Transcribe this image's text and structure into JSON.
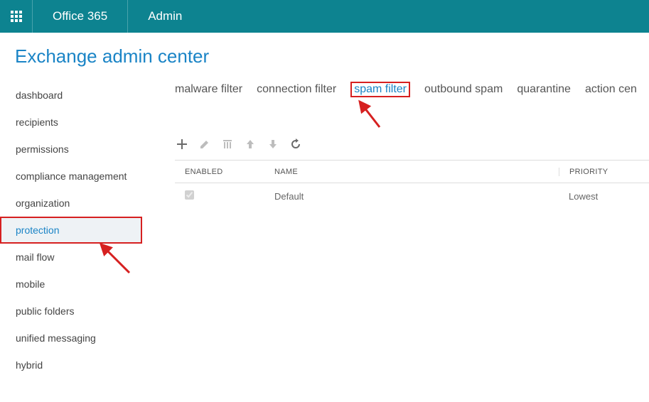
{
  "topbar": {
    "brand": "Office 365",
    "admin": "Admin"
  },
  "pageTitle": "Exchange admin center",
  "sidebar": {
    "items": [
      {
        "label": "dashboard"
      },
      {
        "label": "recipients"
      },
      {
        "label": "permissions"
      },
      {
        "label": "compliance management"
      },
      {
        "label": "organization"
      },
      {
        "label": "protection"
      },
      {
        "label": "mail flow"
      },
      {
        "label": "mobile"
      },
      {
        "label": "public folders"
      },
      {
        "label": "unified messaging"
      },
      {
        "label": "hybrid"
      }
    ]
  },
  "tabs": [
    {
      "label": "malware filter"
    },
    {
      "label": "connection filter"
    },
    {
      "label": "spam filter"
    },
    {
      "label": "outbound spam"
    },
    {
      "label": "quarantine"
    },
    {
      "label": "action cen"
    }
  ],
  "table": {
    "headers": {
      "enabled": "ENABLED",
      "name": "NAME",
      "priority": "PRIORITY"
    },
    "rows": [
      {
        "enabled": true,
        "name": "Default",
        "priority": "Lowest"
      }
    ]
  }
}
